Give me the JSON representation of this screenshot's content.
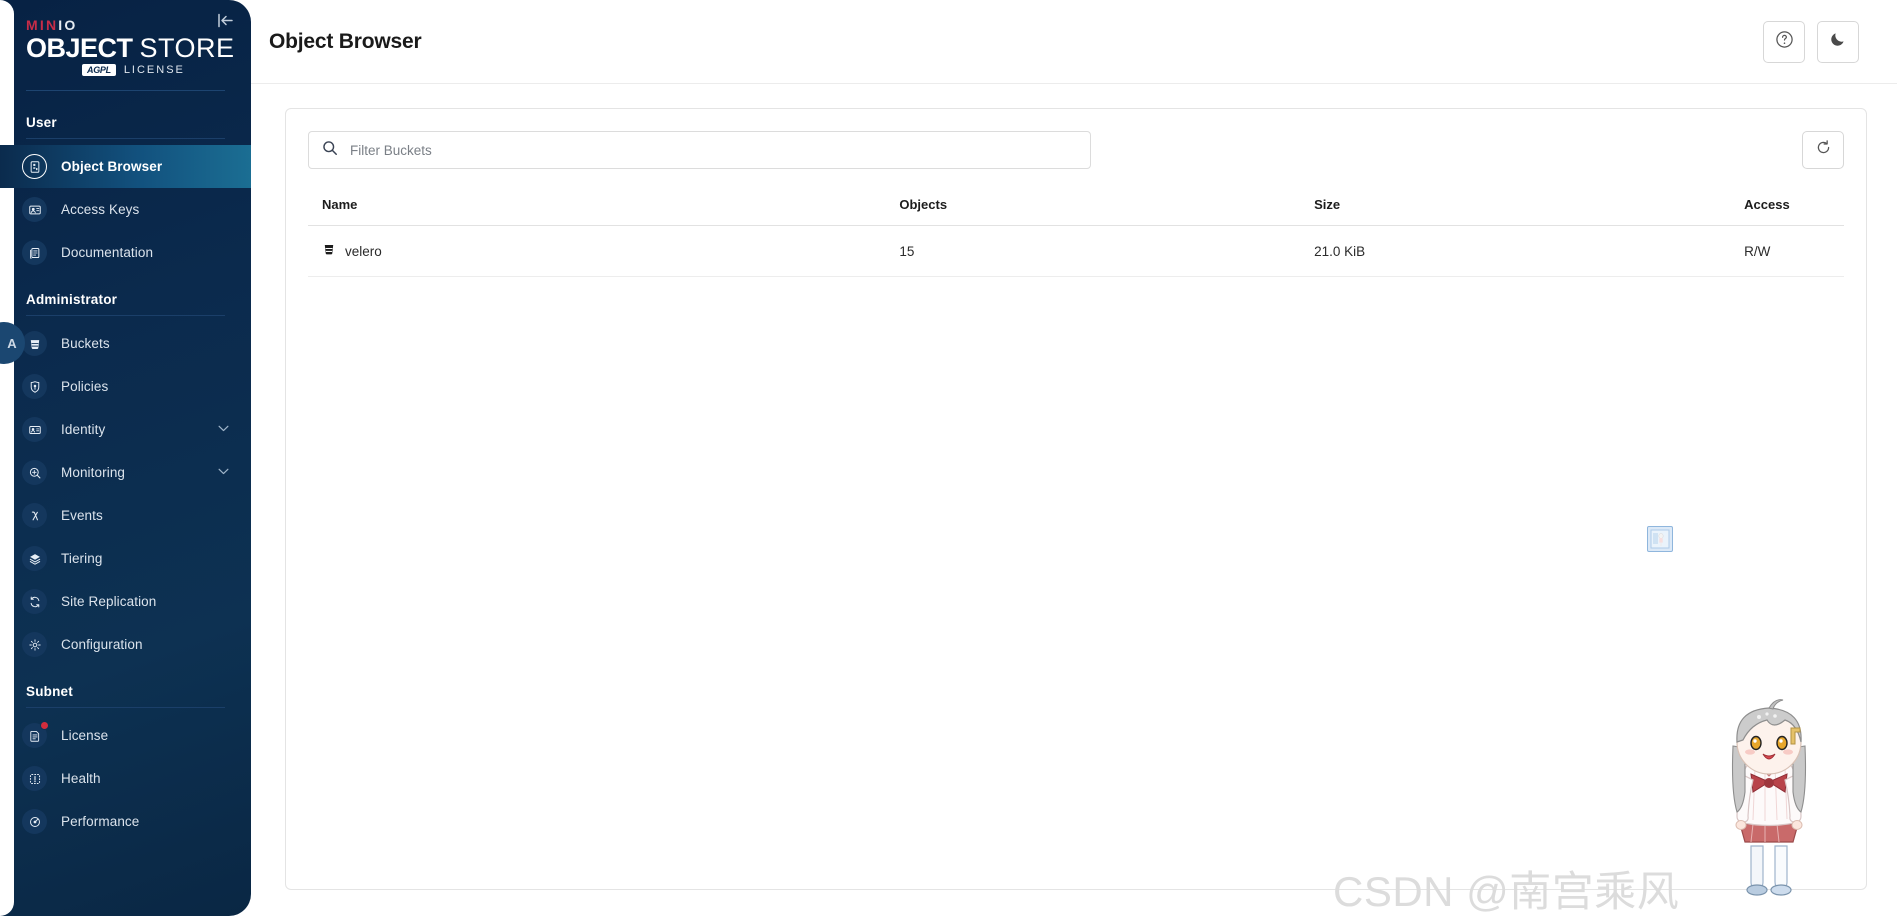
{
  "brand": {
    "minio_min": "MIN",
    "minio_io": "IO",
    "object": "OBJECT",
    "store": "STORE",
    "agpl_badge": "AGPL",
    "license_text": "LICENSE",
    "collapse_icon": "collapse-sidebar-icon",
    "avatar_initial": "A"
  },
  "sidebar": {
    "sections": [
      {
        "title": "User",
        "items": [
          {
            "label": "Object Browser",
            "icon": "object-browser-icon",
            "active": true,
            "chevron": false,
            "badge": false
          },
          {
            "label": "Access Keys",
            "icon": "access-keys-icon",
            "active": false,
            "chevron": false,
            "badge": false
          },
          {
            "label": "Documentation",
            "icon": "documentation-icon",
            "active": false,
            "chevron": false,
            "badge": false
          }
        ]
      },
      {
        "title": "Administrator",
        "items": [
          {
            "label": "Buckets",
            "icon": "bucket-icon",
            "active": false,
            "chevron": false,
            "badge": false
          },
          {
            "label": "Policies",
            "icon": "policy-lock-icon",
            "active": false,
            "chevron": false,
            "badge": false
          },
          {
            "label": "Identity",
            "icon": "identity-card-icon",
            "active": false,
            "chevron": true,
            "badge": false
          },
          {
            "label": "Monitoring",
            "icon": "monitoring-icon",
            "active": false,
            "chevron": true,
            "badge": false
          },
          {
            "label": "Events",
            "icon": "lambda-events-icon",
            "active": false,
            "chevron": false,
            "badge": false
          },
          {
            "label": "Tiering",
            "icon": "tiering-layers-icon",
            "active": false,
            "chevron": false,
            "badge": false
          },
          {
            "label": "Site Replication",
            "icon": "site-replication-icon",
            "active": false,
            "chevron": false,
            "badge": false
          },
          {
            "label": "Configuration",
            "icon": "gear-icon",
            "active": false,
            "chevron": false,
            "badge": false
          }
        ]
      },
      {
        "title": "Subnet",
        "items": [
          {
            "label": "License",
            "icon": "license-icon",
            "active": false,
            "chevron": false,
            "badge": true
          },
          {
            "label": "Health",
            "icon": "health-icon",
            "active": false,
            "chevron": false,
            "badge": false
          },
          {
            "label": "Performance",
            "icon": "performance-icon",
            "active": false,
            "chevron": false,
            "badge": false
          }
        ]
      }
    ]
  },
  "header": {
    "title": "Object Browser",
    "help_button": "help-icon",
    "dark_mode_button": "moon-icon"
  },
  "toolbar": {
    "search_placeholder": "Filter Buckets",
    "search_value": "",
    "search_icon": "search-icon",
    "refresh_icon": "refresh-icon"
  },
  "table": {
    "columns": [
      "Name",
      "Objects",
      "Size",
      "Access"
    ],
    "rows": [
      {
        "name": "velero",
        "objects": "15",
        "size": "21.0 KiB",
        "access": "R/W",
        "icon": "bucket-icon"
      }
    ]
  },
  "overlay": {
    "watermark": "CSDN @南宫乘风",
    "mascot": "anime-chibi-mascot",
    "thumbnail": "mascot-thumbnail-icon"
  },
  "colors": {
    "sidebar_bg": "#0b2a4d",
    "accent_red": "#c72c48",
    "active_gradient_end": "#1b6e93",
    "badge_red": "#d22d3d"
  }
}
